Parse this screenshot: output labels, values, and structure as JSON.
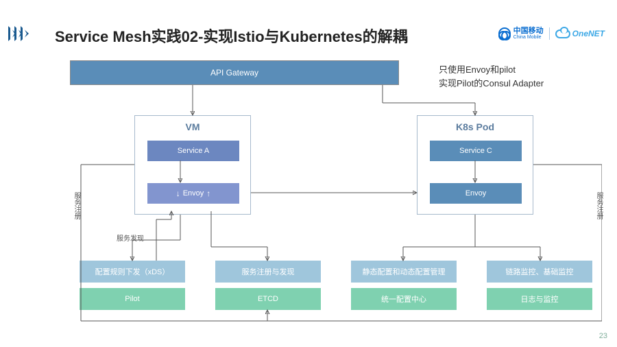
{
  "header": {
    "title": "Service Mesh实践02-实现Istio与Kubernetes的解耦",
    "logo_cm_cn": "中国移动",
    "logo_cm_en": "China Mobile",
    "logo_onenet": "OneNET"
  },
  "side_note": {
    "line1": "只使用Envoy和pilot",
    "line2": "实现Pilot的Consul Adapter"
  },
  "diagram": {
    "api_gateway": "API Gateway",
    "vm": {
      "title": "VM",
      "service": "Service A",
      "envoy": "Envoy"
    },
    "k8s": {
      "title": "K8s Pod",
      "service": "Service C",
      "envoy": "Envoy"
    },
    "labels": {
      "service_register_left": "服务注册",
      "service_register_right": "服务注册",
      "service_discovery": "服务发现"
    },
    "row1": {
      "a": "配置规则下发（xDS）",
      "b": "服务注册与发现",
      "c": "静态配置和动态配置管理",
      "d": "链路监控、基础监控"
    },
    "row2": {
      "a": "Pilot",
      "b": "ETCD",
      "c": "统一配置中心",
      "d": "日志与监控"
    }
  },
  "page_number": "23"
}
